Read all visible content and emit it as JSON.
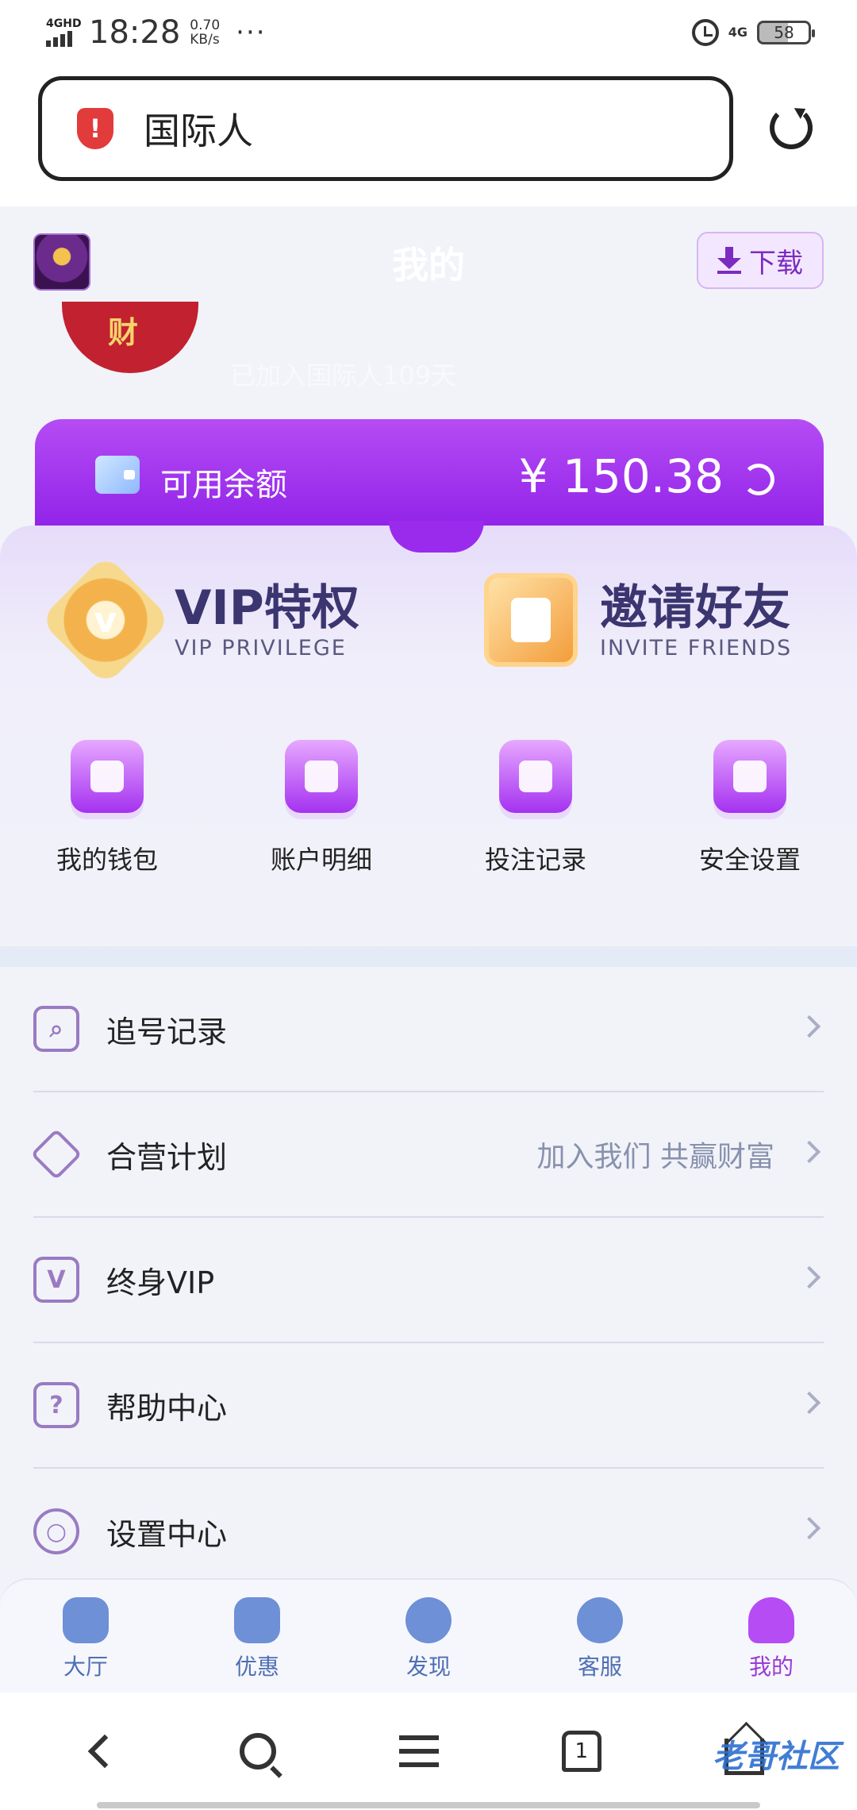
{
  "status_bar": {
    "network": "4GHD",
    "time": "18:28",
    "speed_value": "0.70",
    "speed_unit": "KB/s",
    "dots": "···",
    "network_right": "4G",
    "battery": "58"
  },
  "address_bar": {
    "site_name": "国际人",
    "shield_mark": "!"
  },
  "header": {
    "title": "我的",
    "download_label": "下载"
  },
  "profile": {
    "avatar_char": "财",
    "joined_text": "已加入国际人109天"
  },
  "balance": {
    "label": "可用余额",
    "amount": "¥ 150.38"
  },
  "promos": [
    {
      "title": "VIP特权",
      "subtitle": "VIP PRIVILEGE",
      "badge_text": "v"
    },
    {
      "title": "邀请好友",
      "subtitle": "INVITE FRIENDS"
    }
  ],
  "quick_actions": [
    {
      "label": "我的钱包",
      "icon": "wallet-icon"
    },
    {
      "label": "账户明细",
      "icon": "yuan-receipt-icon"
    },
    {
      "label": "投注记录",
      "icon": "bet-history-icon"
    },
    {
      "label": "安全设置",
      "icon": "security-shield-icon"
    }
  ],
  "menu": [
    {
      "label": "追号记录",
      "hint": "",
      "icon": "search-record-icon",
      "glyph": "⌕"
    },
    {
      "label": "合营计划",
      "hint": "加入我们 共赢财富",
      "icon": "handshake-icon",
      "glyph": ""
    },
    {
      "label": "终身VIP",
      "hint": "",
      "icon": "vip-user-icon",
      "glyph": "V"
    },
    {
      "label": "帮助中心",
      "hint": "",
      "icon": "help-icon",
      "glyph": "?"
    },
    {
      "label": "设置中心",
      "hint": "",
      "icon": "settings-gear-icon",
      "glyph": "○"
    }
  ],
  "tabs": [
    {
      "label": "大厅",
      "icon": "home-icon",
      "active": false
    },
    {
      "label": "优惠",
      "icon": "promo-star-icon",
      "active": false
    },
    {
      "label": "发现",
      "icon": "compass-icon",
      "active": false
    },
    {
      "label": "客服",
      "icon": "chat-icon",
      "active": false
    },
    {
      "label": "我的",
      "icon": "user-icon",
      "active": true
    }
  ],
  "browser_nav": {
    "tab_count": "1",
    "watermark": "老哥社区"
  },
  "colors": {
    "accent": "#9a2bed",
    "balance_top": "#b54cf4",
    "tab_inactive": "#4f6fb4",
    "tab_active": "#9b3ad8"
  }
}
